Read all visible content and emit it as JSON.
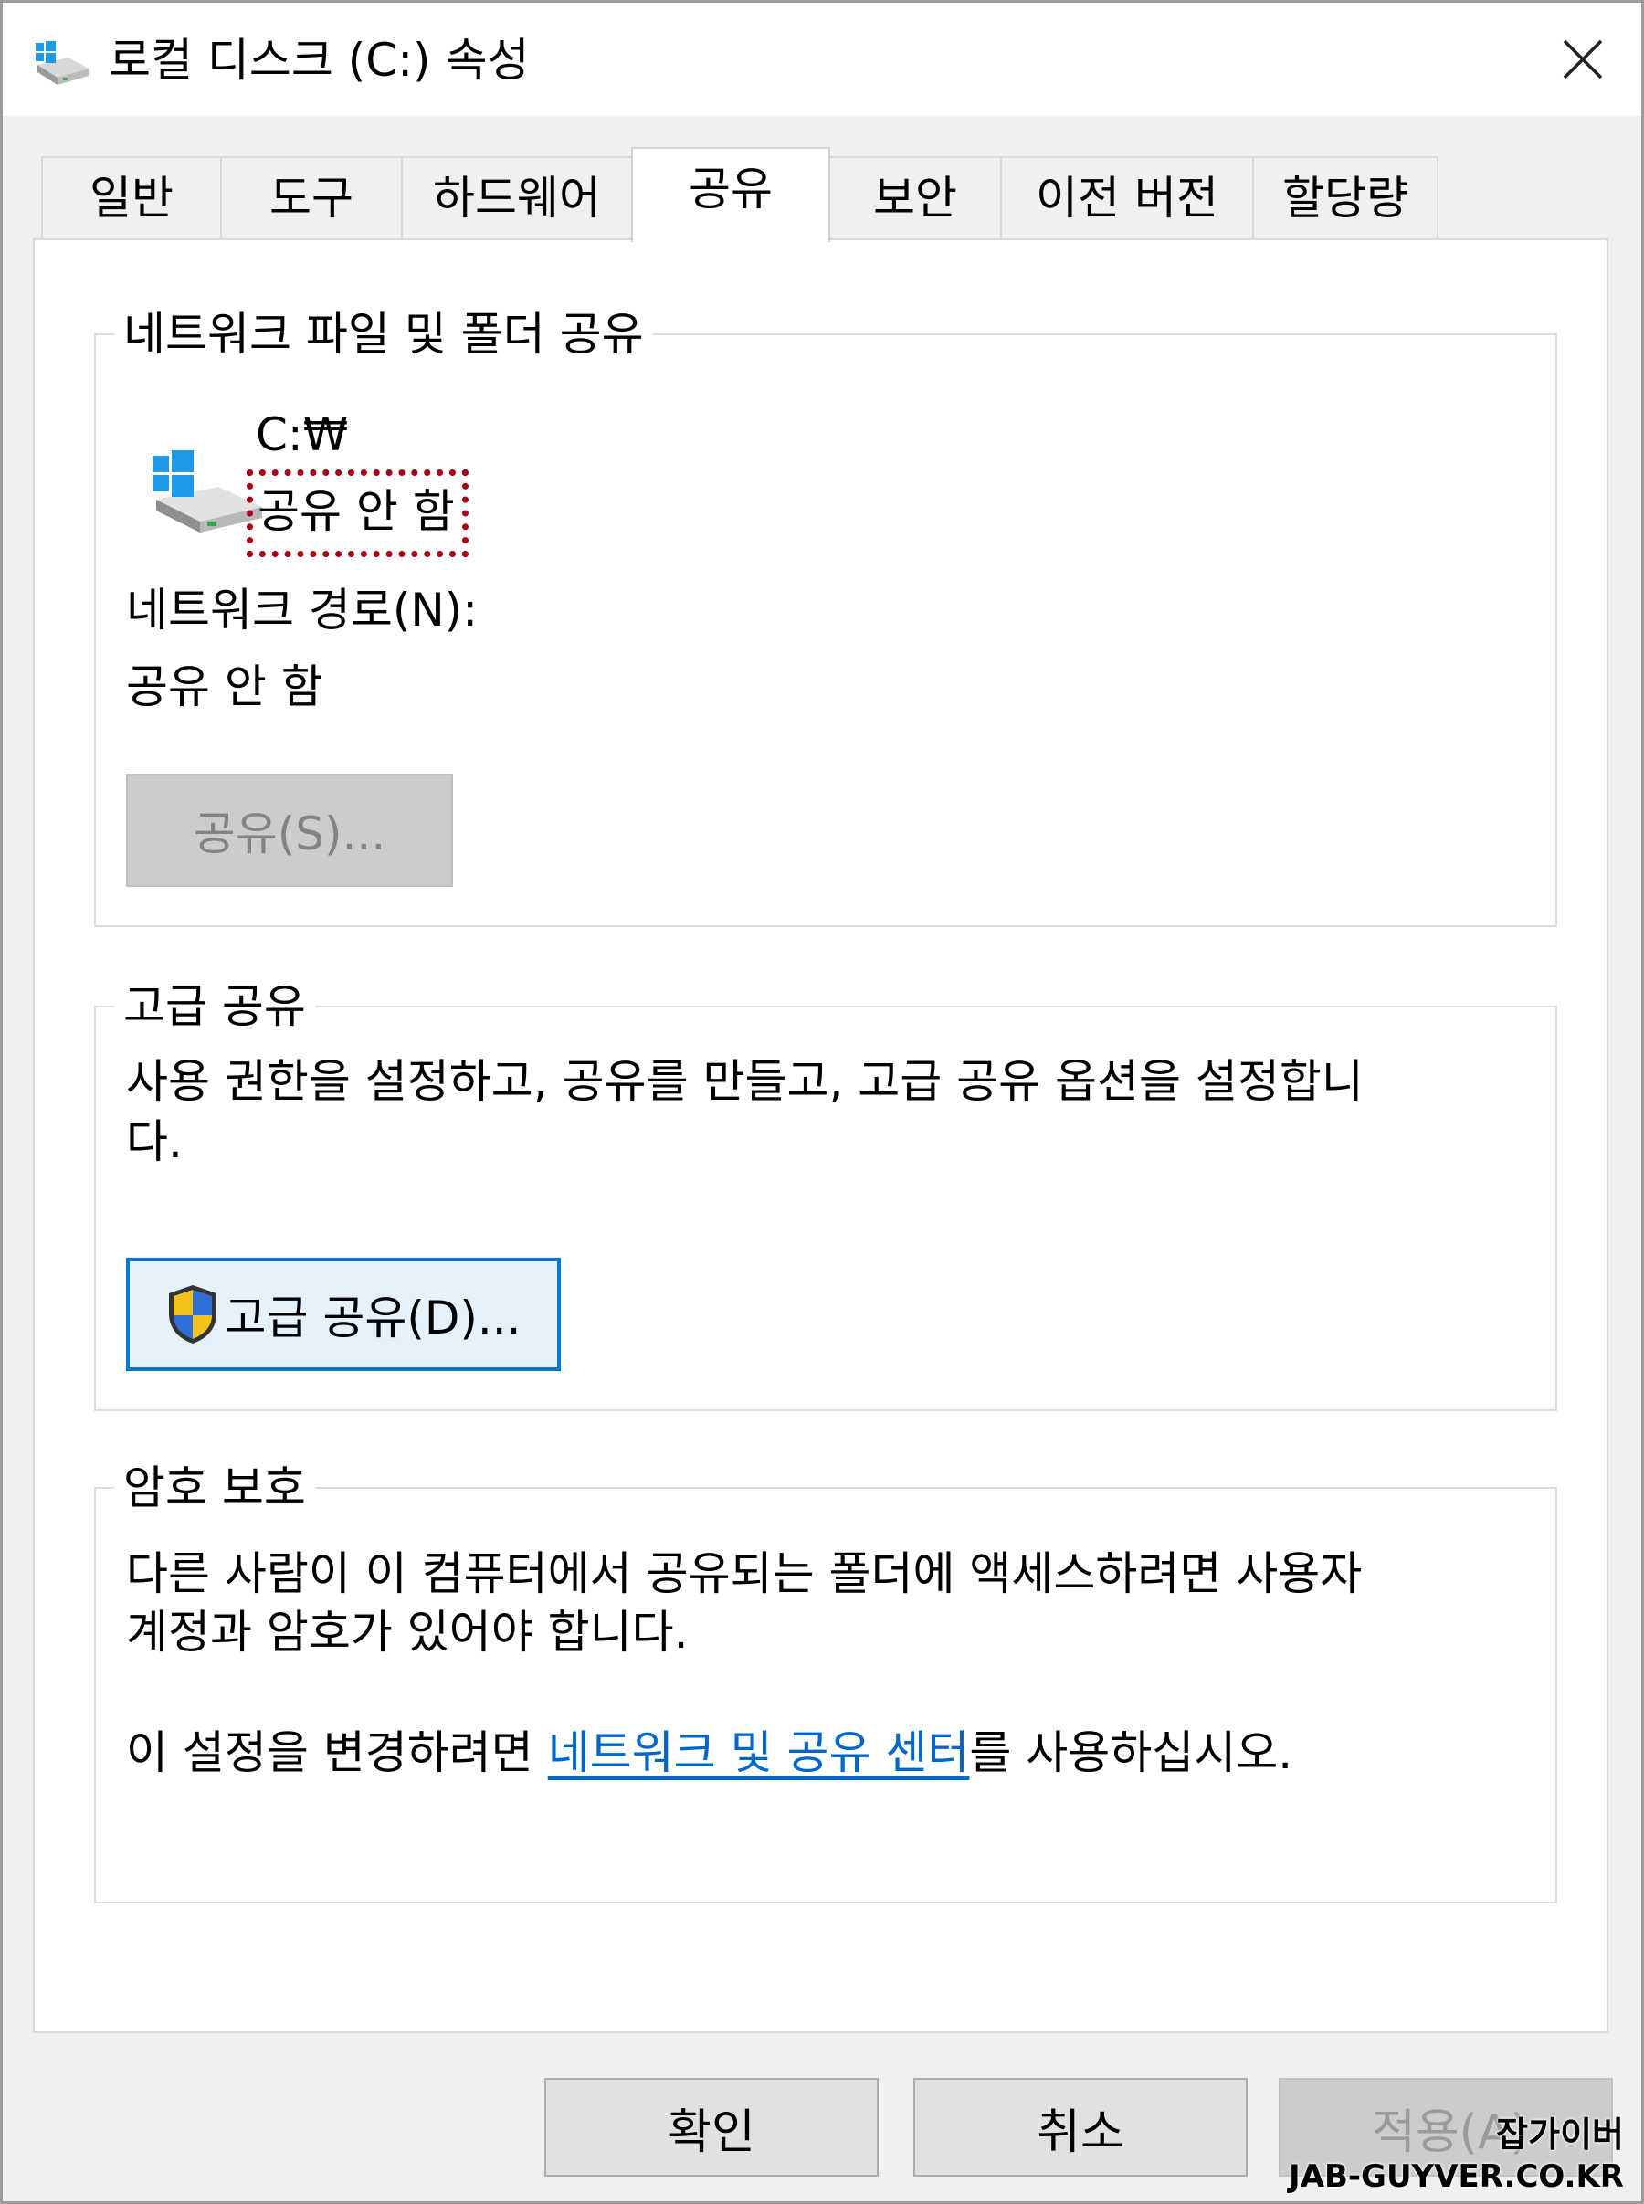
{
  "window": {
    "title": "로컬 디스크 (C:) 속성",
    "icon": "drive-icon",
    "close_icon": "close-icon"
  },
  "tabs": [
    {
      "label": "일반",
      "active": false
    },
    {
      "label": "도구",
      "active": false
    },
    {
      "label": "하드웨어",
      "active": false
    },
    {
      "label": "공유",
      "active": true
    },
    {
      "label": "보안",
      "active": false
    },
    {
      "label": "이전 버전",
      "active": false
    },
    {
      "label": "할당량",
      "active": false
    }
  ],
  "network_sharing": {
    "legend": "네트워크 파일 및 폴더 공유",
    "drive_path": "C:₩",
    "share_status": "공유 안 함",
    "network_path_label": "네트워크 경로(N):",
    "network_path_value": "공유 안 함",
    "share_button": "공유(S)..."
  },
  "advanced_sharing": {
    "legend": "고급 공유",
    "description_line1": "사용 권한을 설정하고, 공유를 만들고, 고급 공유 옵션을 설정합니",
    "description_line2": "다.",
    "button": "고급 공유(D)...",
    "button_icon": "uac-shield-icon"
  },
  "password_protection": {
    "legend": "암호 보호",
    "description_line1": "다른 사람이 이 컴퓨터에서 공유되는 폴더에 액세스하려면 사용자",
    "description_line2": "계정과 암호가 있어야 합니다.",
    "change_prefix": "이 설정을 변경하려면 ",
    "link_text": "네트워크 및 공유 센터",
    "change_suffix": "를 사용하십시오."
  },
  "footer": {
    "ok": "확인",
    "cancel": "취소",
    "apply": "적용(A)"
  },
  "watermark": {
    "line1": "잡가이버",
    "line2": "JAB-GUYVER.CO.KR"
  },
  "colors": {
    "accent": "#0078d7",
    "link": "#0066cc",
    "highlight": "#a30016",
    "dialog_bg": "#f0f0f0",
    "panel_bg": "#ffffff"
  }
}
